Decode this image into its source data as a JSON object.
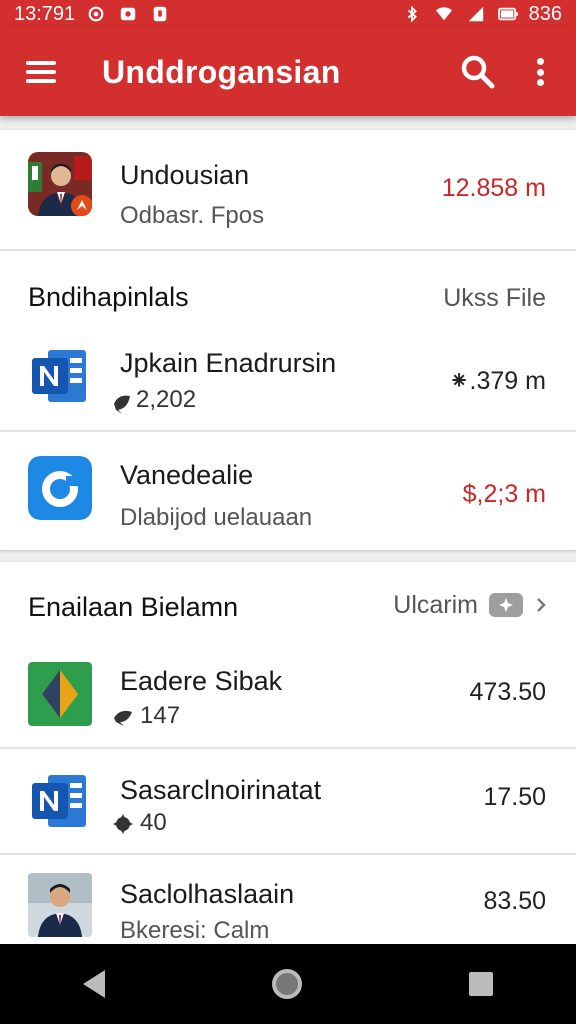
{
  "status_bar": {
    "time": "13:791",
    "battery_text": "836"
  },
  "app_bar": {
    "title": "Unddrogansian"
  },
  "account": {
    "name": "Undousian",
    "subtitle": "Odbasr. Fpos",
    "amount": "12.858 m"
  },
  "section1": {
    "header": "Bndihapinlals",
    "link": "Ukss File",
    "items": [
      {
        "title": "Jpkain Enadrursin",
        "subtitle": "2,202",
        "amount": "⁕.379 m",
        "icon": "onenote-icon"
      },
      {
        "title": "Vanedealie",
        "subtitle": "Dlabijod uelauaan",
        "amount": "$,2;3 m",
        "icon": "blue-circle-app-icon"
      }
    ]
  },
  "section2": {
    "header": "Enailaan Bielamn",
    "link": "Ulcarim",
    "items": [
      {
        "title": "Eadere Sibak",
        "subtitle": "147",
        "amount": "473.50",
        "icon": "green-diamond-app-icon"
      },
      {
        "title": "Sasarclnoirinatat",
        "subtitle": "40",
        "amount": "17.50",
        "icon": "onenote-icon"
      },
      {
        "title": "Saclolhaslaain",
        "subtitle": "Bkeresi: Calm",
        "amount": "83.50",
        "icon": "person-photo"
      }
    ]
  },
  "colors": {
    "primary": "#d32f2f",
    "amount_red": "#c62828"
  }
}
